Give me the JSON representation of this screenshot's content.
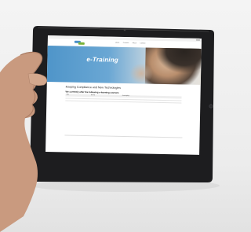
{
  "site": {
    "title": "e-Training",
    "subtitle": "",
    "nav": [
      "Home",
      "Courses",
      "About",
      "Contact"
    ],
    "colors": {
      "accent": "#4a90c8",
      "brand_green": "#7bb33a",
      "hero_start": "#4f95c9"
    }
  },
  "main": {
    "heading": "Keeping Compliance and New Technologies",
    "paragraphs": [
      "",
      ""
    ],
    "section_heading": "We currently offer the following e-learning courses:"
  },
  "courses_table": {
    "headers": [
      "Title",
      "Brand",
      "Description",
      ""
    ],
    "rows": [
      {
        "title": "",
        "brand": "",
        "description": "",
        "action": ""
      },
      {
        "title": "",
        "brand": "",
        "description": "",
        "action": ""
      }
    ]
  },
  "icons": {
    "device": "tablet-device",
    "hand": "holding-hand"
  }
}
